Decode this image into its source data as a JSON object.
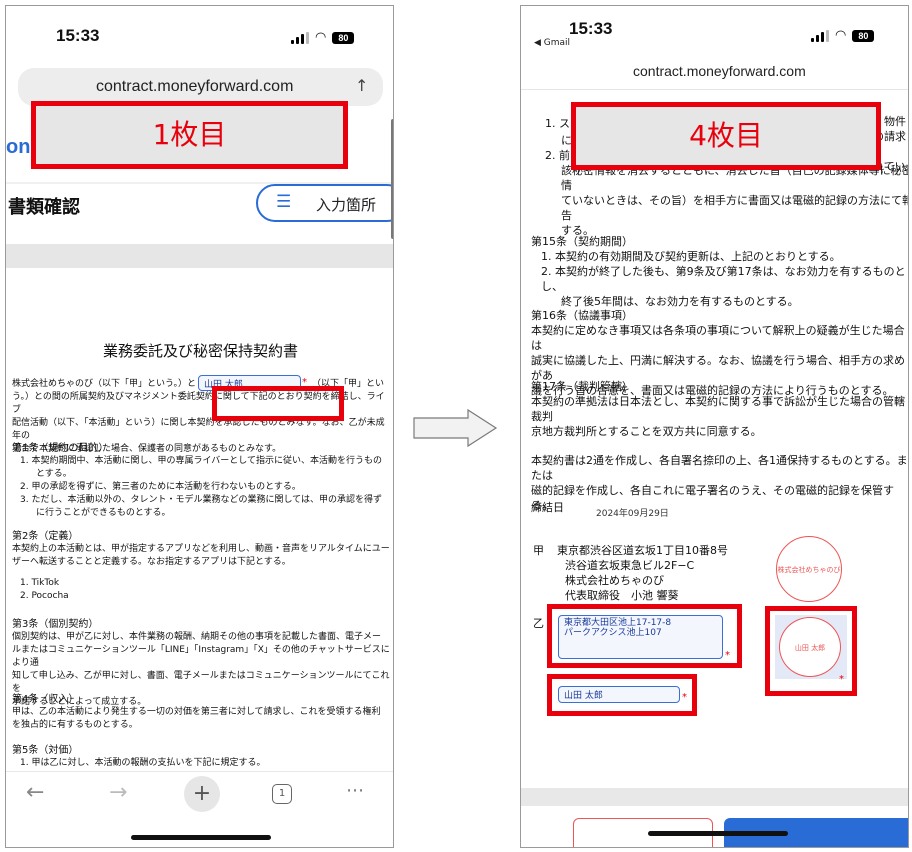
{
  "left": {
    "status": {
      "time": "15:33",
      "battery": "80"
    },
    "url": "contract.moneyforward.com",
    "logo_fragment": "one",
    "page_label": "1枚目",
    "header_title": "書類確認",
    "input_button_label": "入力箇所",
    "doc": {
      "title": "業務委託及び秘密保持契約書",
      "intro_a": "株式会社めちゃのび（以下「甲」という。）と",
      "name_field": "山田 太郎",
      "intro_b": "（以下「甲」とい",
      "intro_c": "う。）との間の所属契約及びマネジメント委託契約に関して下記のとおり契約を締結し、ライブ",
      "intro_d": "配信活動（以下、「本活動」という）に関し本契約を承認したものとみなす。なお、乙が未成年の",
      "intro_e": "場合で本契約に承認した場合、保護者の同意があるものとみなす。",
      "art1_h": "第1条（規約の目的）",
      "art1_1": "1.  本契約期間中、本活動に関し、甲の専属ライバーとして指示に従い、本活動を行うもの",
      "art1_1b": "とする。",
      "art1_2": "2.  甲の承認を得ずに、第三者のために本活動を行わないものとする。",
      "art1_3": "3.  ただし、本活動以外の、タレント・モデル業務などの業務に関しては、甲の承認を得ず",
      "art1_3b": "に行うことができるものとする。",
      "art2_h": "第2条（定義）",
      "art2_1": "本契約上の本活動とは、甲が指定するアプリなどを利用し、動画・音声をリアルタイムにユー",
      "art2_2": "ザーへ転送することと定義する。なお指定するアプリは下記とする。",
      "art2_l1": "1.  TikTok",
      "art2_l2": "2.  Pococha",
      "art3_h": "第3条（個別契約）",
      "art3_1": "個別契約は、甲が乙に対し、本件業務の報酬、納期その他の事項を記載した書面、電子メー",
      "art3_2": "ルまたはコミュニケーションツール「LINE」「Instagram」「X」その他のチャットサービスにより通",
      "art3_3": "知して申し込み、乙が甲に対し、書面、電子メールまたはコミュニケーションツールにてこれを",
      "art3_4": "承諾することによって成立する。",
      "art4_h": "第4条（収入）",
      "art4_1": "甲は、乙の本活動により発生する一切の対価を第三者に対して請求し、これを受領する権利",
      "art4_2": "を独占的に有するものとする。",
      "art5_h": "第5条（対価）",
      "art5_1": "1.  甲は乙に対し、本活動の報酬の支払いを下記に規定する。"
    },
    "tabs_count": "1"
  },
  "right": {
    "status": {
      "time": "15:33",
      "back_app": "◀ Gmail",
      "battery": "80"
    },
    "url": "contract.moneyforward.com",
    "page_label": "4枚目",
    "doc": {
      "t1": "1.  ス",
      "t1r": "、物件",
      "t1r2": "の請求",
      "t1b": "に",
      "t2": "2.  前",
      "t2r": "れてい",
      "t3": "該秘密情報を消去するとともに、消去した旨（自己の記録媒体等に秘密情",
      "t4": "ていないときは、その旨）を相手方に書面又は電磁的記録の方法にて報告",
      "t5": "する。",
      "a15_h": "第15条（契約期間）",
      "a15_1": "1.  本契約の有効期間及び契約更新は、上記のとおりとする。",
      "a15_2": "2.  本契約が終了した後も、第9条及び第17条は、なお効力を有するものとし、",
      "a15_2b": "終了後5年間は、なお効力を有するものとする。",
      "a16_h": "第16条（協議事項）",
      "a16_1": "本契約に定めなき事項又は各条項の事項について解釈上の疑義が生じた場合は",
      "a16_2": "誠実に協議した上、円満に解決する。なお、協議を行う場合、相手方の求めがあ",
      "a16_3": "議を行う旨の合意を、書面又は電磁的記録の方法により行うものとする。",
      "a17_h": "第17条（裁判管轄）",
      "a17_1": "本契約の準拠法は日本法とし、本契約に関する事で訴訟が生じた場合の管轄裁判",
      "a17_2": "京地方裁判所とすることを双方共に同意する。",
      "close_1": "本契約書は2通を作成し、各自署名捺印の上、各1通保持するものとする。または",
      "close_2": "磁的記録を作成し、各自これに電子署名のうえ、その電磁的記録を保管する。",
      "date_label": "締結日",
      "date_value": "2024年09月29日",
      "party_a_mark": "甲",
      "party_a_1": "東京都渋谷区道玄坂1丁目10番8号",
      "party_a_2": "渋谷道玄坂東急ビル2F−C",
      "party_a_3": "株式会社めちゃのび",
      "party_a_4": "代表取締役　小池 響葵",
      "seal_a": "株式会社めちゃのび",
      "party_b_mark": "乙",
      "address_field_1": "東京都大田区池上17-17-8",
      "address_field_2": "パークアクシス池上107",
      "name_field": "山田 太郎",
      "seal_b": "山田 太郎"
    }
  },
  "arrow": "→"
}
